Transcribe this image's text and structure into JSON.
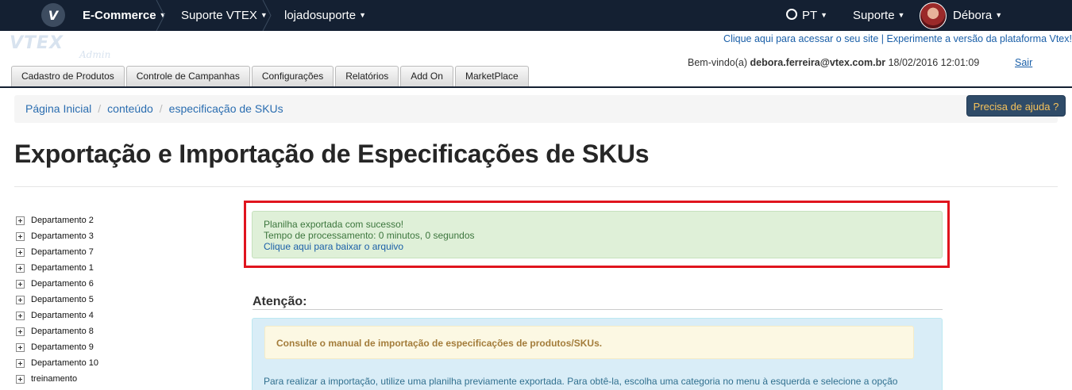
{
  "topnav": {
    "logo_letter": "V",
    "crumbs": [
      "E-Commerce",
      "Suporte VTEX",
      "lojadosuporte"
    ],
    "language": "PT",
    "support": "Suporte",
    "user": "Débora",
    "caret": "⌄"
  },
  "header": {
    "logo": "VTEX",
    "logo_sub": "Admin",
    "link_site": "Clique aqui para acessar o seu site",
    "link_divider": "|",
    "link_new": "Experimente a versão da plataforma Vtex!",
    "welcome_prefix": "Bem-vindo(a)",
    "welcome_email": "debora.ferreira@vtex.com.br",
    "welcome_date": "18/02/2016 12:01:09",
    "logout": "Sair"
  },
  "tabs": [
    "Cadastro de Produtos",
    "Controle de Campanhas",
    "Configurações",
    "Relatórios",
    "Add On",
    "MarketPlace"
  ],
  "breadcrumb": {
    "items": [
      "Página Inicial",
      "conteúdo",
      "especificação de SKUs"
    ],
    "separator": "/"
  },
  "help_button": "Precisa de ajuda ?",
  "page_title": "Exportação e Importação de Especificações de SKUs",
  "tree": [
    "Departamento 2",
    "Departamento 3",
    "Departamento 7",
    "Departamento 1",
    "Departamento 6",
    "Departamento 5",
    "Departamento 4",
    "Departamento 8",
    "Departamento 9",
    "Departamento 10",
    "treinamento"
  ],
  "success": {
    "line1": "Planilha exportada com sucesso!",
    "line2": "Tempo de processamento: 0 minutos, 0 segundos",
    "link": "Clique aqui para baixar o arquivo"
  },
  "attention": {
    "heading": "Atenção:",
    "warning": "Consulte o manual de importação de especificações de produtos/SKUs.",
    "text": "Para realizar a importação, utilize uma planilha previamente exportada. Para obtê-la, escolha uma categoria no menu à esquerda e selecione a opção"
  },
  "colors": {
    "nav_bg": "#142032",
    "success_bg": "#dff0d8",
    "highlight": "#e0141e",
    "help_text": "#f6c25a"
  }
}
